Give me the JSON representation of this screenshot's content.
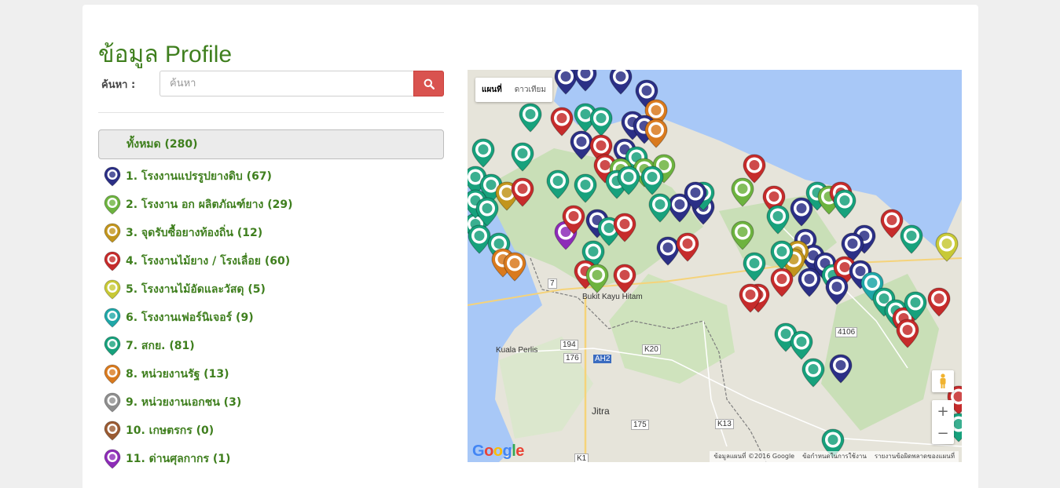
{
  "page": {
    "title": "ข้อมูล Profile"
  },
  "search": {
    "label": "ค้นหา :",
    "placeholder": "ค้นหา",
    "value": "",
    "button_icon": "search-icon"
  },
  "all_item": {
    "label": "ทั้งหมด (280)"
  },
  "categories": [
    {
      "label": "1. โรงงานแปรรูปยางดิบ (67)",
      "color": "#2b2f86",
      "icon": "factory-pin-icon"
    },
    {
      "label": "2. โรงงาน อก ผลิตภัณฑ์ยาง (29)",
      "color": "#6db33f",
      "icon": "factory-pin-icon"
    },
    {
      "label": "3. จุดรับซื้อยางท้องถิ่น (12)",
      "color": "#c2951c",
      "icon": "market-pin-icon"
    },
    {
      "label": "4. โรงงานไม้ยาง / โรงเลื่อย (60)",
      "color": "#c62b2b",
      "icon": "factory-pin-icon"
    },
    {
      "label": "5. โรงงานไม้อัดและวัสดุ (5)",
      "color": "#c8c936",
      "icon": "factory-pin-icon"
    },
    {
      "label": "6. โรงงานเฟอร์นิเจอร์ (9)",
      "color": "#1fa7a8",
      "icon": "factory-pin-icon"
    },
    {
      "label": "7. สกย. (81)",
      "color": "#17a17c",
      "icon": "emblem-pin-icon"
    },
    {
      "label": "8. หน่วยงานรัฐ (13)",
      "color": "#d97a1e",
      "icon": "government-pin-icon"
    },
    {
      "label": "9. หน่วยงานเอกชน (3)",
      "color": "#8e8e8e",
      "icon": "people-pin-icon"
    },
    {
      "label": "10. เกษตรกร (0)",
      "color": "#9a5a32",
      "icon": "farmer-pin-icon"
    },
    {
      "label": "11. ด่านศุลกากร (1)",
      "color": "#8d2bb8",
      "icon": "customs-pin-icon"
    }
  ],
  "map": {
    "type_map": "แผนที่",
    "type_satellite": "ดาวเทียม",
    "zoom_in": "+",
    "zoom_out": "−",
    "logo": "Google",
    "footer_data": "ข้อมูลแผนที่ ©2016 Google",
    "footer_terms": "ข้อกำหนดในการใช้งาน",
    "footer_report": "รายงานข้อผิดพลาดของแผนที่",
    "places": {
      "bukit_kayu_hitam": "Bukit Kayu Hitam",
      "kuala_perlis": "Kuala Perlis",
      "jitra": "Jitra",
      "road_4106": "4106",
      "road_k20": "K20",
      "road_ah2": "AH2",
      "road_k13": "K13",
      "road_175": "175",
      "road_176": "176",
      "road_194": "194",
      "road_k1": "K1",
      "road_7": "7"
    }
  }
}
